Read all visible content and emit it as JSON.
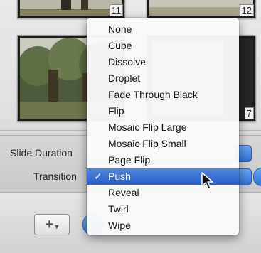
{
  "thumbnails": [
    {
      "number": "11"
    },
    {
      "number": "12"
    },
    {
      "number": "7"
    }
  ],
  "settings": {
    "slide_duration_label": "Slide Duration",
    "transition_label": "Transition"
  },
  "transition_menu": {
    "items": [
      {
        "label": "None"
      },
      {
        "label": "Cube"
      },
      {
        "label": "Dissolve"
      },
      {
        "label": "Droplet"
      },
      {
        "label": "Fade Through Black"
      },
      {
        "label": "Flip"
      },
      {
        "label": "Mosaic Flip Large"
      },
      {
        "label": "Mosaic Flip Small"
      },
      {
        "label": "Page Flip"
      },
      {
        "label": "Push"
      },
      {
        "label": "Reveal"
      },
      {
        "label": "Twirl"
      },
      {
        "label": "Wipe"
      }
    ],
    "selected_label": "Push",
    "check_glyph": "✓"
  },
  "toolbar": {
    "add_button_glyph": "+",
    "add_button_caret": "▾"
  },
  "colors": {
    "selection_blue": "#2a5fc9",
    "button_blue": "#3a77d8"
  }
}
